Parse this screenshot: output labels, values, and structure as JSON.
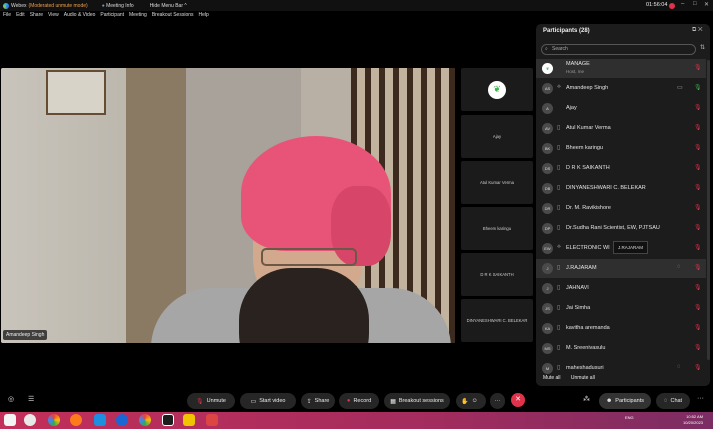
{
  "titlebar": {
    "app": "Webex",
    "mode": "(Moderated unmute mode)",
    "meeting_info": "Meeting Info",
    "hide_menu": "Hide Menu Bar",
    "hide_menu_arrow": "^",
    "clock": "01:56:04",
    "minimize": "–",
    "maximize": "□",
    "close": "✕"
  },
  "menu": [
    "File",
    "Edit",
    "Share",
    "View",
    "Audio & Video",
    "Participant",
    "Meeting",
    "Breakout Sessions",
    "Help"
  ],
  "main_video": {
    "name": "Amandeep Singh"
  },
  "thumbnails": [
    "",
    "Ajay",
    "Atul Kumar Verma",
    "Bheem karingu",
    "D R K SAIKANTH",
    "DINYANESHWARI C. BELEKAR"
  ],
  "panel": {
    "title": "Participants (28)",
    "search_placeholder": "Search",
    "popout": "⧉",
    "close": "✕",
    "sort": "⇅",
    "participants": [
      {
        "initials": "",
        "name": "MANAGE",
        "sub": "Host, me",
        "selected": true,
        "mic": "🎙",
        "icon": "",
        "dev": ""
      },
      {
        "initials": "AS",
        "name": "Amandeep Singh",
        "sub": "",
        "mic": "🎙",
        "icon": "▭",
        "dev": "⟡",
        "mic_on": true
      },
      {
        "initials": "A",
        "name": "Ajay",
        "sub": "",
        "mic": "🎙",
        "icon": "",
        "dev": ""
      },
      {
        "initials": "AV",
        "name": "Atul Kumar Verma",
        "sub": "",
        "mic": "🎙",
        "icon": "",
        "dev": "▯"
      },
      {
        "initials": "BK",
        "name": "Bheem karingu",
        "sub": "",
        "mic": "🎙",
        "icon": "",
        "dev": "▯"
      },
      {
        "initials": "DS",
        "name": "D R K SAIKANTH",
        "sub": "",
        "mic": "🎙",
        "icon": "",
        "dev": "▯"
      },
      {
        "initials": "DB",
        "name": "DINYANESHWARI C. BELEKAR",
        "sub": "",
        "mic": "🎙",
        "icon": "",
        "dev": "▯"
      },
      {
        "initials": "DR",
        "name": "Dr. M. Ravikishore",
        "sub": "",
        "mic": "🎙",
        "icon": "",
        "dev": "▯"
      },
      {
        "initials": "DP",
        "name": "Dr.Sudha Rani Scientist, EW, PJTSAU",
        "sub": "",
        "mic": "🎙",
        "icon": "",
        "dev": "▯"
      },
      {
        "initials": "EW",
        "name": "ELECTRONIC WI",
        "sub": "",
        "mic": "🎙",
        "icon": "",
        "dev": "⟡"
      },
      {
        "initials": "J",
        "name": "J.RAJARAM",
        "sub": "",
        "selected": true,
        "mic": "🎙",
        "icon": "◌",
        "dev": "▯"
      },
      {
        "initials": "J",
        "name": "JAHNAVI",
        "sub": "",
        "mic": "🎙",
        "icon": "",
        "dev": "▯"
      },
      {
        "initials": "JS",
        "name": "Jai Simha",
        "sub": "",
        "mic": "🎙",
        "icon": "",
        "dev": "▯"
      },
      {
        "initials": "KA",
        "name": "kavitha aremanda",
        "sub": "",
        "mic": "🎙",
        "icon": "",
        "dev": "▯"
      },
      {
        "initials": "MS",
        "name": "M. Sreenivasulu",
        "sub": "",
        "mic": "🎙",
        "icon": "",
        "dev": "▯"
      },
      {
        "initials": "M",
        "name": "maheshadusuri",
        "sub": "",
        "mic": "🎙",
        "icon": "◌",
        "dev": "▯"
      }
    ],
    "tooltip": "J.RAJARAM",
    "mute_all": "Mute all",
    "unmute_all": "Unmute all"
  },
  "toolbar": {
    "unmute": "Unmute",
    "start_video": "Start video",
    "share": "Share",
    "record": "Record",
    "breakout": "Breakout sessions",
    "more": "···",
    "participants": "Participants",
    "chat": "Chat"
  },
  "taskbar": {
    "lang": "ENG",
    "time": "10:52 AM",
    "date": "10/20/2023"
  },
  "colors": {
    "accent_red": "#e0324a",
    "panel_bg": "#1c1c1c",
    "turban": "#e85478"
  }
}
